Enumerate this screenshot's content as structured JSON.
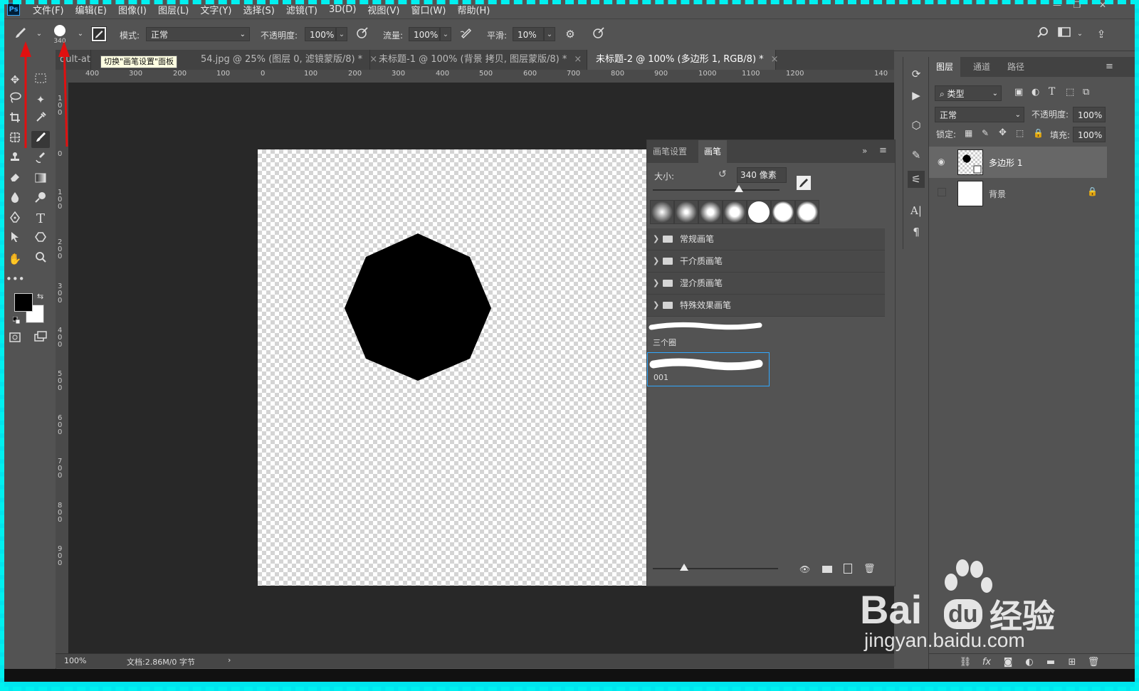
{
  "app": {
    "logo_text": "Ps"
  },
  "menu": [
    "文件(F)",
    "编辑(E)",
    "图像(I)",
    "图层(L)",
    "文字(Y)",
    "选择(S)",
    "滤镜(T)",
    "3D(D)",
    "视图(V)",
    "窗口(W)",
    "帮助(H)"
  ],
  "options_bar": {
    "brush_size": "340",
    "mode_label": "模式:",
    "mode_value": "正常",
    "opacity_label": "不透明度:",
    "opacity_value": "100%",
    "flow_label": "流量:",
    "flow_value": "100%",
    "smooth_label": "平滑:",
    "smooth_value": "10%"
  },
  "tooltip": "切换\"画笔设置\"面板",
  "doc_tabs": [
    {
      "label": "dult-at",
      "close": ""
    },
    {
      "label": "54.jpg @ 25% (图层 0, 滤镜蒙版/8) *",
      "close": "×"
    },
    {
      "label": "未标题-1 @ 100% (背景 拷贝, 图层蒙版/8) *",
      "close": "×"
    },
    {
      "label": "未标题-2 @ 100% (多边形 1, RGB/8) *",
      "close": "×"
    }
  ],
  "ruler_h": [
    "400",
    "300",
    "200",
    "100",
    "0",
    "100",
    "200",
    "300",
    "400",
    "500",
    "600",
    "700",
    "800",
    "900",
    "1000",
    "1100",
    "1200",
    "140"
  ],
  "ruler_v": [
    "100",
    "0",
    "100",
    "200",
    "300",
    "400",
    "500",
    "600",
    "700",
    "800",
    "900"
  ],
  "status": {
    "zoom": "100%",
    "doc_info": "文档:2.86M/0 字节",
    "arrow": "›"
  },
  "brush_panel": {
    "tabs": [
      "画笔设置",
      "画笔"
    ],
    "size_label": "大小:",
    "size_value": "340 像素",
    "size_fraction": 0.68,
    "folders": [
      "常规画笔",
      "干介质画笔",
      "湿介质画笔",
      "特殊效果画笔"
    ],
    "strokes": [
      "三个圈",
      "001"
    ],
    "preview_fraction": 0.25
  },
  "layers_panel": {
    "tabs": [
      "图层",
      "通道",
      "路径"
    ],
    "filter_value": "类型",
    "blend_value": "正常",
    "opacity_label": "不透明度:",
    "opacity_value": "100%",
    "lock_label": "锁定:",
    "fill_label": "填充:",
    "fill_value": "100%",
    "layers": [
      {
        "name": "多边形 1",
        "visible": true,
        "selected": true
      },
      {
        "name": "背景",
        "visible": false,
        "selected": false
      }
    ],
    "bottom_fx": "fx"
  },
  "watermark": {
    "brand": "Bai",
    "brand2": "du",
    "brand_cn": "经验",
    "url": "jingyan.baidu.com"
  },
  "colors": {
    "foreground": "#000000",
    "background": "#ffffff",
    "annotation_arrow": "#e01010",
    "selection_highlight": "#31a8ff"
  }
}
